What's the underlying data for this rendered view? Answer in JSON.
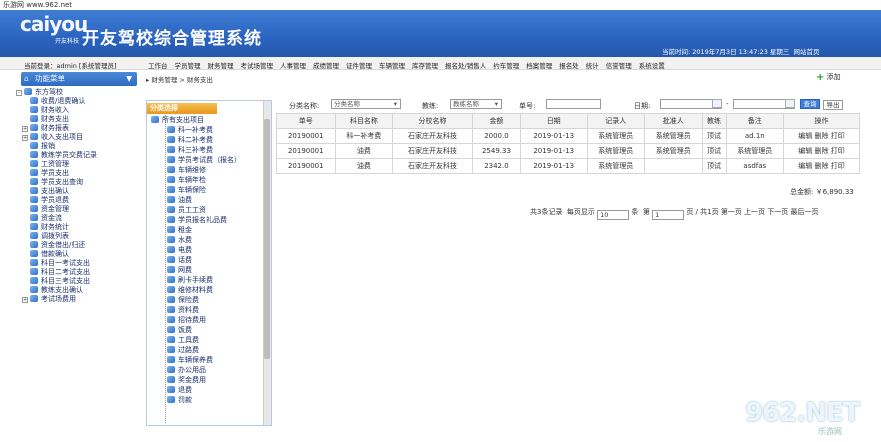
{
  "watermark_top": "乐游网 www.962.net",
  "header": {
    "logo_text": "caiyou",
    "logo_sub": "开友科技",
    "app_title": "开友驾校综合管理系统",
    "time_text": "当前时间: 2019年7月3日 13:47:23 星期三",
    "extra_link": "网站首页"
  },
  "login": {
    "text": "当前登录：admin [系统管理员]"
  },
  "menu": [
    "工作台",
    "学员管理",
    "财务管理",
    "考试场管理",
    "人事管理",
    "成绩管理",
    "证件管理",
    "车辆管理",
    "库存管理",
    "报名处/销售人",
    "约车管理",
    "档案管理",
    "报名处",
    "统计",
    "信誉管理",
    "系统设置"
  ],
  "func_panel": {
    "title": "功能菜单",
    "home_icon": "home-icon",
    "arrow": "▼"
  },
  "breadcrumb": "财务管理 > 财务支出",
  "add_button": "添加",
  "left_tree": [
    {
      "label": "东方驾校",
      "level": 0,
      "expand": "-"
    },
    {
      "label": "收费/退费确认",
      "level": 1
    },
    {
      "label": "财务收入",
      "level": 1
    },
    {
      "label": "财务支出",
      "level": 1
    },
    {
      "label": "财务报表",
      "level": 1,
      "expand": "+"
    },
    {
      "label": "收入支出项目",
      "level": 1,
      "expand": "+"
    },
    {
      "label": "报销",
      "level": 1
    },
    {
      "label": "教练学员交费记录",
      "level": 1
    },
    {
      "label": "工资管理",
      "level": 1
    },
    {
      "label": "学员支出",
      "level": 1
    },
    {
      "label": "学员支出查询",
      "level": 1
    },
    {
      "label": "支出确认",
      "level": 1
    },
    {
      "label": "学员退费",
      "level": 1
    },
    {
      "label": "资金管理",
      "level": 1
    },
    {
      "label": "资金流",
      "level": 1
    },
    {
      "label": "财务统计",
      "level": 1
    },
    {
      "label": "调拨列表",
      "level": 1
    },
    {
      "label": "资金借出/归还",
      "level": 1
    },
    {
      "label": "借款确认",
      "level": 1
    },
    {
      "label": "科目一考试支出",
      "level": 1
    },
    {
      "label": "科目二考试支出",
      "level": 1
    },
    {
      "label": "科目三考试支出",
      "level": 1
    },
    {
      "label": "教练支出确认",
      "level": 1
    },
    {
      "label": "考试场费用",
      "level": 1,
      "expand": "+"
    }
  ],
  "picker": {
    "title": "分类选择",
    "items": [
      "所有支出项目",
      "科一补考费",
      "科二补考费",
      "科三补考费",
      "学员考试费（报名）",
      "车辆维修",
      "车辆年检",
      "车辆保险",
      "油费",
      "员工工资",
      "学员报名礼品费",
      "租金",
      "水费",
      "电费",
      "话费",
      "网费",
      "刷卡手续费",
      "维修材料费",
      "保险费",
      "资料费",
      "招待费用",
      "饭费",
      "工具费",
      "过路费",
      "车辆保养费",
      "办公用品",
      "奖金费用",
      "退费",
      "罚款"
    ]
  },
  "filters": {
    "category_label": "分类名称:",
    "category_value": "分类名称",
    "teacher_label": "教练:",
    "teacher_value": "教练名称",
    "number_label": "单号:",
    "date_label": "日期:",
    "search_button": "查询",
    "export_button": "导出"
  },
  "table": {
    "columns": [
      "单号",
      "科目名称",
      "分校名称",
      "金额",
      "日期",
      "记录人",
      "批准人",
      "教练",
      "备注",
      "操作"
    ],
    "rows": [
      [
        "20190001",
        "科一补考费",
        "石家庄开友科技",
        "2000.0",
        "2019-01-13",
        "系统管理员",
        "系统管理员",
        "顶试",
        "ad.1n",
        "编辑 删除 打印"
      ],
      [
        "20190001",
        "油费",
        "石家庄开友科技",
        "2549.33",
        "2019-01-13",
        "系统管理员",
        "系统管理员",
        "顶试",
        "系统管理员",
        "编辑 删除 打印"
      ],
      [
        "20190001",
        "油费",
        "石家庄开友科技",
        "2342.0",
        "2019-01-13",
        "系统管理员",
        "",
        "顶试",
        "asdfas",
        "编辑 删除 打印"
      ]
    ],
    "total": "总金额: ￥6,890.33"
  },
  "pager": {
    "text_count": "共3条记录",
    "per_page_label": "每页显示",
    "per_page_value": "10",
    "per_page_unit": "条",
    "page_label": "第",
    "page_value": "1",
    "page_total": "页 / 共1页",
    "first": "第一页",
    "prev": "上一页",
    "next": "下一页",
    "last": "最后一页"
  },
  "watermark": {
    "big": "962.NET",
    "small": "乐游网"
  },
  "colors": {
    "banner": "#2a64bf",
    "accent": "#e8971c"
  }
}
